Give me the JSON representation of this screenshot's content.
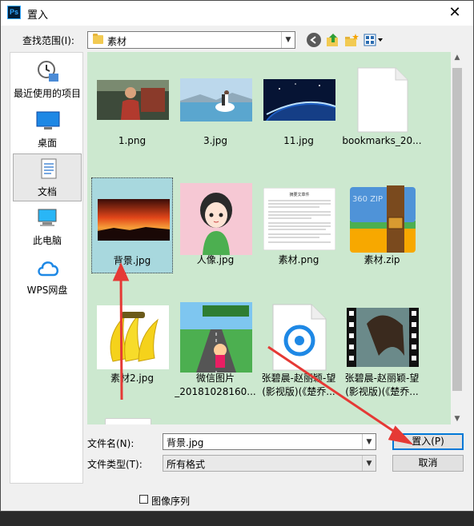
{
  "window": {
    "title": "置入",
    "app_icon": "Ps",
    "close_glyph": "✕"
  },
  "lookin": {
    "label": "查找范围(I):",
    "value": "素材"
  },
  "places": [
    {
      "label": "最近使用的项目",
      "icon": "clock-icon"
    },
    {
      "label": "桌面",
      "icon": "desktop-icon"
    },
    {
      "label": "文档",
      "icon": "documents-icon",
      "selected": true
    },
    {
      "label": "此电脑",
      "icon": "computer-icon"
    },
    {
      "label": "WPS网盘",
      "icon": "cloud-icon"
    }
  ],
  "files": [
    {
      "name": "1.png"
    },
    {
      "name": "3.jpg"
    },
    {
      "name": "11.jpg"
    },
    {
      "name": "bookmarks_20..."
    },
    {
      "name": "背景.jpg",
      "selected": true
    },
    {
      "name": "人像.jpg"
    },
    {
      "name": "素材.png"
    },
    {
      "name": "素材.zip"
    },
    {
      "name": "素材2.jpg"
    },
    {
      "name": "微信图片",
      "name2": "_20181028160..."
    },
    {
      "name": "张碧晨-赵丽颖-望",
      "name2": "(影视版)(《楚乔..."
    },
    {
      "name": "张碧晨-赵丽颖-望",
      "name2": "(影视版)(《楚乔..."
    }
  ],
  "filename": {
    "label": "文件名(N):",
    "value": "背景.jpg"
  },
  "filetype": {
    "label": "文件类型(T):",
    "value": "所有格式"
  },
  "buttons": {
    "place": "置入(P)",
    "cancel": "取消"
  },
  "sequence": {
    "label": "图像序列"
  },
  "thumb_texts": {
    "doc_title": "摘要文章件",
    "zip_label": "360 ZIP"
  },
  "colors": {
    "file_area_bg": "#cce8cf",
    "arrow": "#e53935",
    "primary_border": "#0078d7"
  }
}
